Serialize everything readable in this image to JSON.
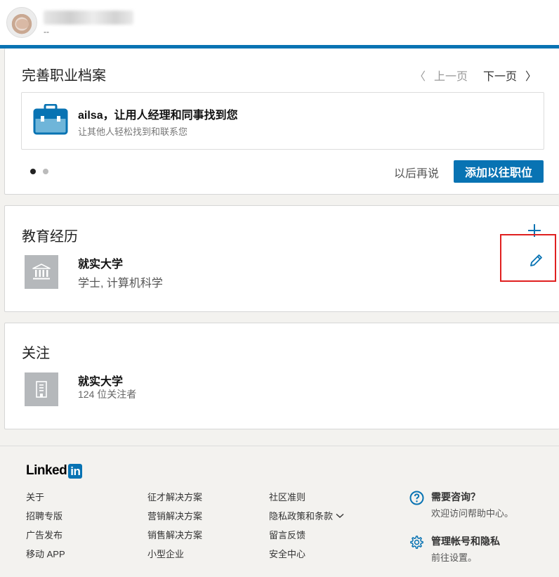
{
  "header": {
    "user_subtitle": "--"
  },
  "profile_card": {
    "title": "完善职业档案",
    "prev_label": "上一页",
    "next_label": "下一页",
    "prev_arrow": "〈",
    "next_arrow": "〉",
    "suggestion_title": "ailsa，让用人经理和同事找到您",
    "suggestion_subtitle": "让其他人轻松找到和联系您",
    "later_label": "以后再说",
    "add_position_label": "添加以往职位"
  },
  "education": {
    "title": "教育经历",
    "school": "就实大学",
    "degree": "学士, 计算机科学"
  },
  "following": {
    "title": "关注",
    "name": "就实大学",
    "followers": "124 位关注者"
  },
  "footer": {
    "logo_text": "Linked",
    "logo_in": "in",
    "col1": [
      "关于",
      "招聘专版",
      "广告发布",
      "移动 APP"
    ],
    "col2": [
      "征才解决方案",
      "营销解决方案",
      "销售解决方案",
      "小型企业"
    ],
    "col3": [
      "社区准则",
      "隐私政策和条款",
      "留言反馈",
      "安全中心"
    ],
    "help_title": "需要咨询？",
    "help_sub": "欢迎访问帮助中心。",
    "settings_title": "管理帐号和隐私",
    "settings_sub": "前往设置。"
  },
  "colors": {
    "brand_blue": "#0873b3",
    "highlight_red": "#e02020"
  },
  "icons": {
    "briefcase": "briefcase-icon",
    "plus": "plus-icon",
    "pencil": "pencil-icon",
    "school": "school-building-icon",
    "company": "company-building-icon",
    "help": "question-circle-icon",
    "settings": "gear-icon",
    "dropdown": "chevron-down-icon"
  }
}
